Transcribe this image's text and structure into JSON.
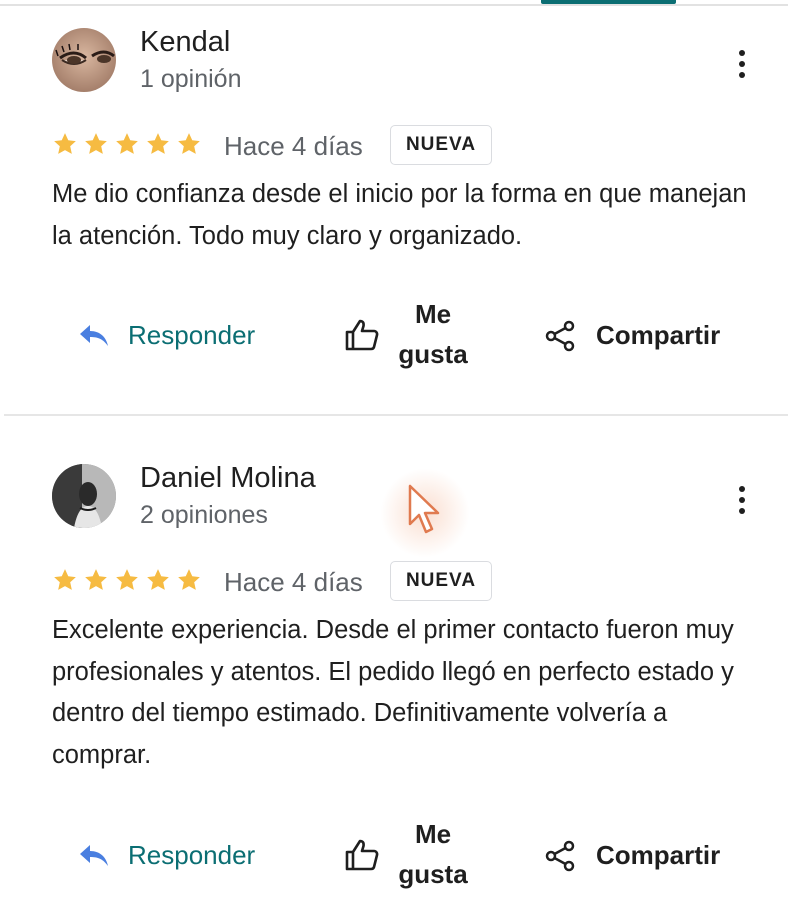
{
  "colors": {
    "accent": "#0b6e73",
    "star": "#f6bb42",
    "reply_icon": "#4a7fe0",
    "muted_text": "#5f6368",
    "divider": "#e6e6e6"
  },
  "reviews": [
    {
      "author": "Kendal",
      "review_count": "1 opinión",
      "rating": 5,
      "date": "Hace 4 días",
      "badge": "NUEVA",
      "text": "Me dio confianza desde el inicio por la forma en que manejan la atención. Todo muy claro y organizado.",
      "actions": {
        "reply": "Responder",
        "like": "Me gusta",
        "share": "Compartir"
      }
    },
    {
      "author": "Daniel Molina",
      "review_count": "2 opiniones",
      "rating": 5,
      "date": "Hace 4 días",
      "badge": "NUEVA",
      "text": "Excelente experiencia. Desde el primer contacto fueron muy profesionales y atentos. El pedido llegó en perfecto estado y dentro del tiempo estimado. Definitivamente volvería a comprar.",
      "actions": {
        "reply": "Responder",
        "like": "Me gusta",
        "share": "Compartir"
      }
    }
  ],
  "icons": {
    "more": "more-vert-icon",
    "star": "star-icon",
    "reply": "reply-arrow-icon",
    "like": "thumb-up-icon",
    "share": "share-icon",
    "cursor": "mouse-pointer-icon"
  }
}
